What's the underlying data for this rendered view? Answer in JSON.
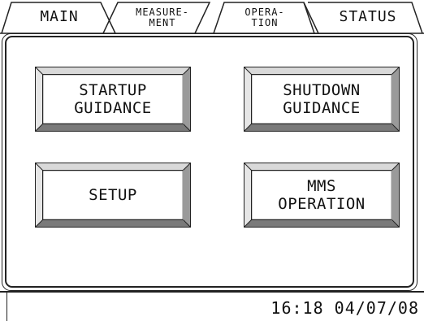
{
  "tabs": [
    {
      "id": "main",
      "label": "MAIN"
    },
    {
      "id": "measurement",
      "label_line1": "MEASURE-",
      "label_line2": "MENT"
    },
    {
      "id": "operation",
      "label_line1": "OPERA-",
      "label_line2": "TION",
      "active": true
    },
    {
      "id": "status",
      "label": "STATUS"
    }
  ],
  "buttons": [
    {
      "id": "startup-guidance",
      "line1": "STARTUP",
      "line2": "GUIDANCE"
    },
    {
      "id": "shutdown-guidance",
      "line1": "SHUTDOWN",
      "line2": "GUIDANCE"
    },
    {
      "id": "setup",
      "line1": "SETUP",
      "line2": ""
    },
    {
      "id": "mms-operation",
      "line1": "MMS",
      "line2": "OPERATION"
    }
  ],
  "status_bar": {
    "clock": "16:18 04/07/08"
  },
  "colors": {
    "ink": "#111111",
    "background": "#ffffff",
    "bevel_dark": "#222222",
    "bevel_light": "#bdbdbd"
  }
}
